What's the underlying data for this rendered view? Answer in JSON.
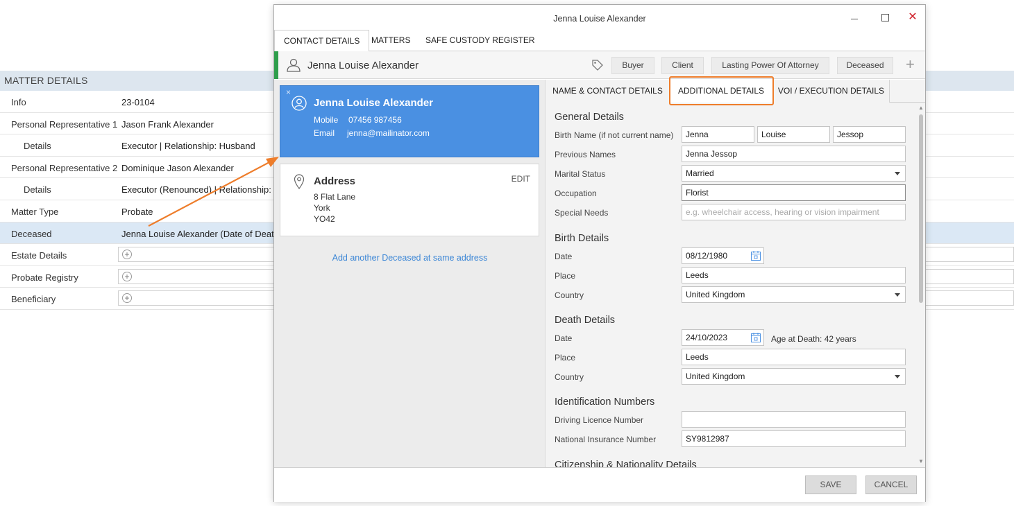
{
  "matter": {
    "header": "MATTER DETAILS",
    "rows": [
      {
        "label": "Info",
        "value": "23-0104"
      },
      {
        "label": "Personal Representative 1",
        "value": "Jason Frank Alexander"
      },
      {
        "label": "Details",
        "value": "Executor | Relationship: Husband"
      },
      {
        "label": "Personal Representative 2",
        "value": "Dominique Jason Alexander"
      },
      {
        "label": "Details",
        "value": "Executor (Renounced) | Relationship: S"
      },
      {
        "label": "Matter Type",
        "value": "Probate"
      },
      {
        "label": "Deceased",
        "value": "Jenna Louise Alexander (Date of Death"
      },
      {
        "label": "Estate Details"
      },
      {
        "label": "Probate Registry"
      },
      {
        "label": "Beneficiary"
      }
    ]
  },
  "dialog": {
    "title": "Jenna Louise Alexander",
    "tabs": [
      "CONTACT DETAILS",
      "MATTERS",
      "SAFE CUSTODY REGISTER"
    ],
    "contact_name": "Jenna Louise Alexander",
    "roles": [
      "Buyer",
      "Client",
      "Lasting Power Of Attorney",
      "Deceased"
    ],
    "role_add": "+",
    "accent_color": "#2e9e4b",
    "card": {
      "close": "×",
      "name": "Jenna Louise Alexander",
      "mobile_label": "Mobile",
      "mobile": "07456 987456",
      "email_label": "Email",
      "email": "jenna@mailinator.com",
      "color": "#4a90e2"
    },
    "address": {
      "heading": "Address",
      "edit": "EDIT",
      "lines": [
        "8 Flat Lane",
        "York",
        "YO42"
      ]
    },
    "add_another": "Add another Deceased at same address",
    "subtabs": [
      "NAME & CONTACT DETAILS",
      "ADDITIONAL DETAILS",
      "VOI / EXECUTION DETAILS"
    ],
    "highlight_color": "#ee7d2b",
    "general": {
      "heading": "General Details",
      "birth_name_label": "Birth Name (if not current name)",
      "birth_first": "Jenna",
      "birth_middle": "Louise",
      "birth_last": "Jessop",
      "previous_names_label": "Previous Names",
      "previous_names": "Jenna Jessop",
      "marital_label": "Marital Status",
      "marital": "Married",
      "occupation_label": "Occupation",
      "occupation": "Florist",
      "special_label": "Special Needs",
      "special_placeholder": "e.g. wheelchair access, hearing or vision impairment"
    },
    "birth": {
      "heading": "Birth Details",
      "date_label": "Date",
      "date": "08/12/1980",
      "place_label": "Place",
      "place": "Leeds",
      "country_label": "Country",
      "country": "United Kingdom"
    },
    "death": {
      "heading": "Death Details",
      "date_label": "Date",
      "date": "24/10/2023",
      "age": "Age at Death: 42 years",
      "place_label": "Place",
      "place": "Leeds",
      "country_label": "Country",
      "country": "United Kingdom"
    },
    "ident": {
      "heading": "Identification Numbers",
      "driving_label": "Driving Licence Number",
      "driving": "",
      "ni_label": "National Insurance Number",
      "ni": "SY9812987"
    },
    "citizenship_heading": "Citizenship & Nationality Details",
    "save": "SAVE",
    "cancel": "CANCEL"
  }
}
